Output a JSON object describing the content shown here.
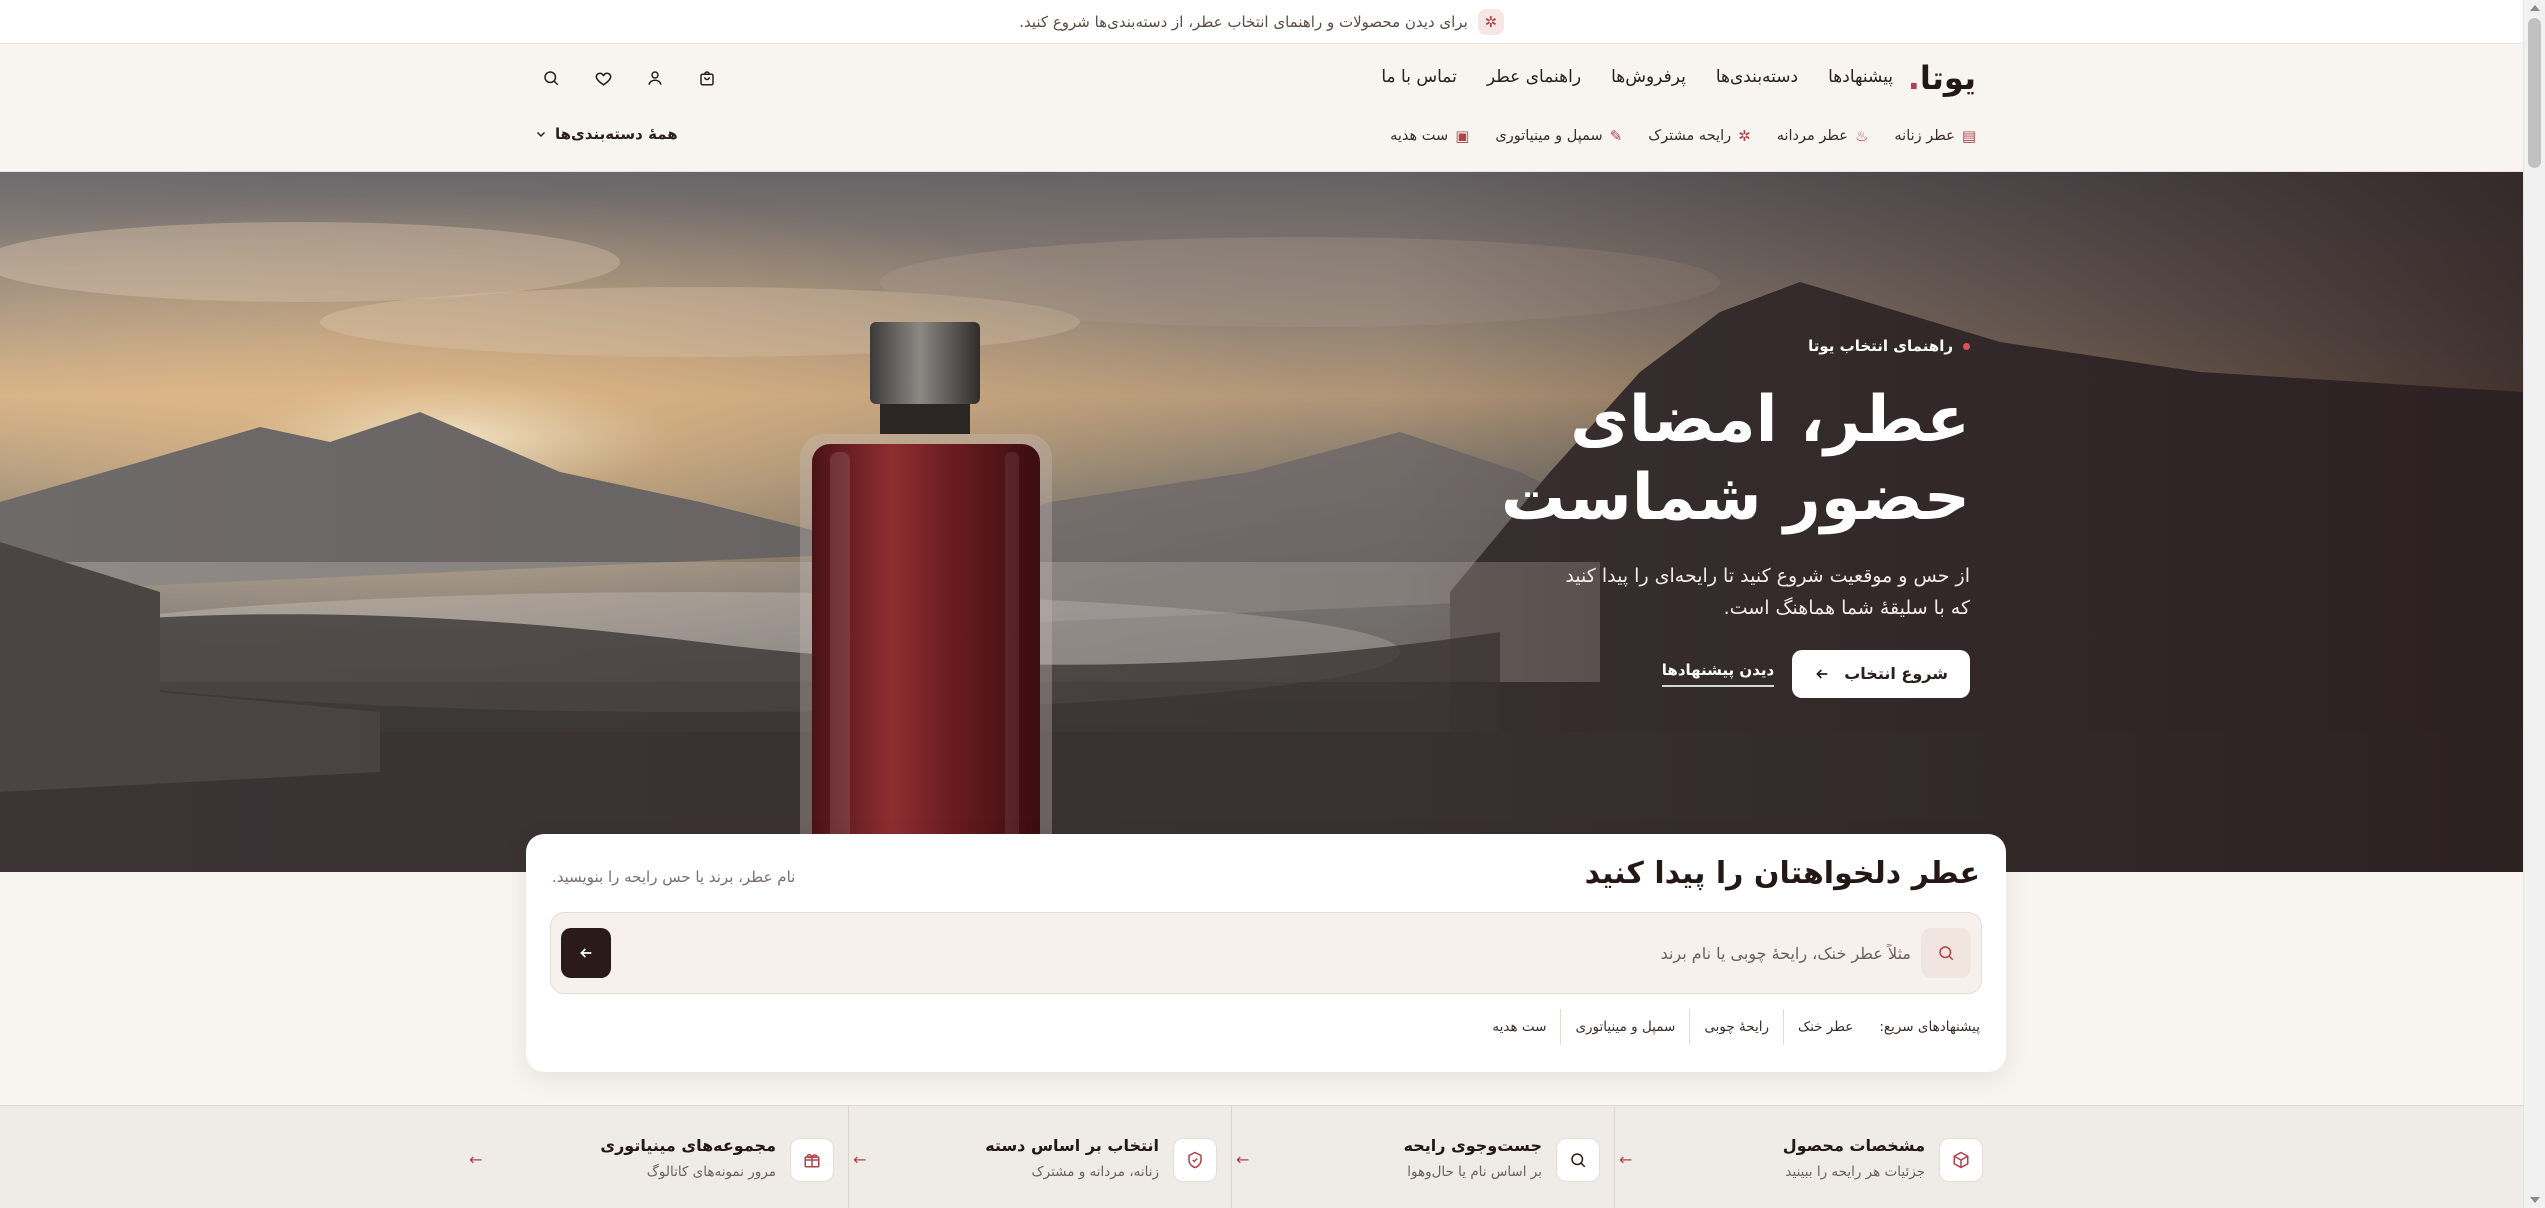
{
  "announcement": {
    "text": "برای دیدن محصولات و راهنمای انتخاب عطر، از دسته‌بندی‌ها شروع کنید.",
    "icon": "sparkle-icon"
  },
  "header": {
    "logo": "یوتا",
    "nav": [
      "پیشنهادها",
      "دسته‌بندی‌ها",
      "پرفروش‌ها",
      "راهنمای عطر",
      "تماس با ما"
    ],
    "icons": [
      "search-icon",
      "heart-icon",
      "user-icon",
      "bag-icon"
    ],
    "categories": [
      {
        "label": "عطر زنانه",
        "icon": "bottle-icon"
      },
      {
        "label": "عطر مردانه",
        "icon": "flame-icon"
      },
      {
        "label": "رایحه مشترک",
        "icon": "sparkle-icon"
      },
      {
        "label": "سمپل و مینیاتوری",
        "icon": "dropper-icon"
      },
      {
        "label": "ست هدیه",
        "icon": "gift-icon"
      }
    ],
    "all_categories": "همهٔ دسته‌بندی‌ها"
  },
  "hero": {
    "eyebrow": "راهنمای انتخاب یوتا",
    "title_line1": "عطر، امضای",
    "title_line2": "حضور شماست",
    "subtitle": "از حس و موقعیت شروع کنید تا رایحه‌ای را پیدا کنید که با سلیقهٔ شما هماهنگ است.",
    "primary_cta": "شروع انتخاب",
    "secondary_cta": "دیدن پیشنهادها"
  },
  "search": {
    "title": "عطر دلخواهتان را پیدا کنید",
    "hint": "نام عطر، برند یا حس رایحه را بنویسید.",
    "placeholder": "مثلاً عطر خنک، رایحهٔ چوبی یا نام برند",
    "value": "",
    "quick_label": "پیشنهادهای سریع:",
    "quick": [
      "عطر خنک",
      "رایحهٔ چوبی",
      "سمپل و مینیاتوری",
      "ست هدیه"
    ]
  },
  "features": [
    {
      "title": "مشخصات محصول",
      "desc": "جزئیات هر رایحه را ببینید",
      "icon": "box-icon"
    },
    {
      "title": "جست‌وجوی رایحه",
      "desc": "بر اساس نام یا حال‌وهوا",
      "icon": "search-icon"
    },
    {
      "title": "انتخاب بر اساس دسته",
      "desc": "زنانه، مردانه و مشترک",
      "icon": "shield-icon"
    },
    {
      "title": "مجموعه‌های مینیاتوری",
      "desc": "مرور نمونه‌های کاتالوگ",
      "icon": "gift-icon"
    }
  ],
  "colors": {
    "accent": "#b3414a",
    "dark": "#2a1b18",
    "background": "#f8f5f1"
  }
}
